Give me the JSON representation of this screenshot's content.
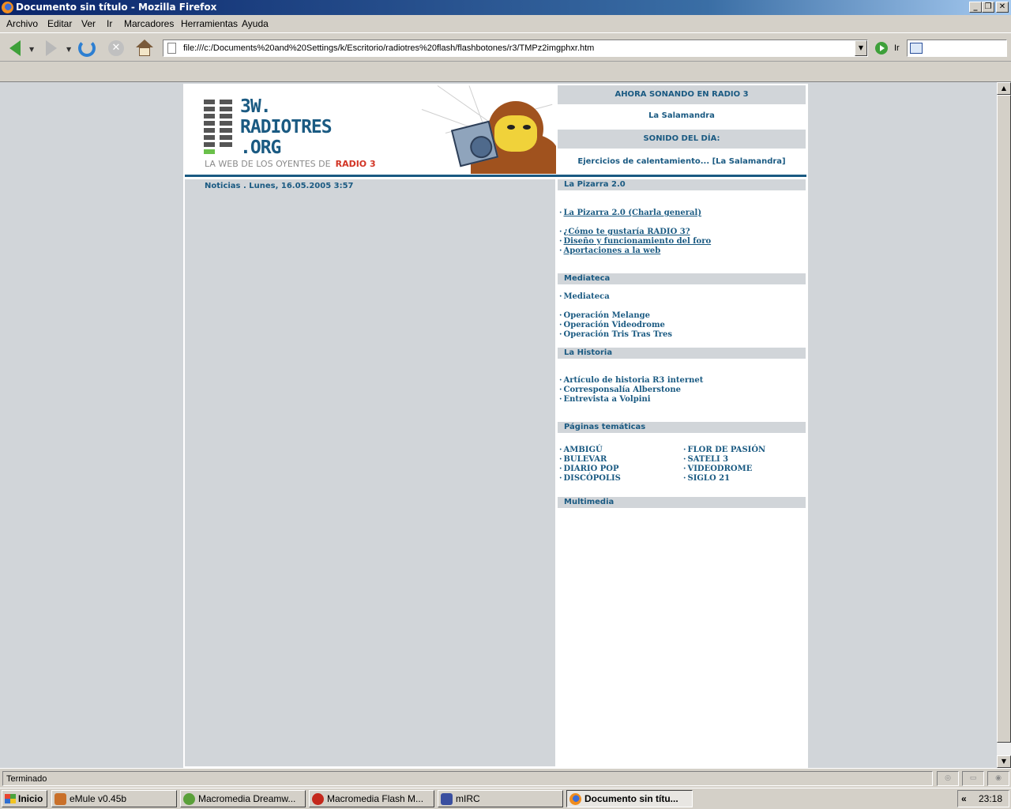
{
  "window": {
    "title": "Documento sin título - Mozilla Firefox"
  },
  "menu": [
    "Archivo",
    "Editar",
    "Ver",
    "Ir",
    "Marcadores",
    "Herramientas",
    "Ayuda"
  ],
  "toolbar": {
    "url": "file:///c:/Documents%20and%20Settings/k/Escritorio/radiotres%20flash/flashbotones/r3/TMPz2imgphxr.htm",
    "go_label": "Ir"
  },
  "banner": {
    "logo_line1": "3W.",
    "logo_line2": "RADIOTRES",
    "logo_line3": ".ORG",
    "tagline": "LA WEB DE LOS OYENTES DE",
    "tagline_accent": "RADIO 3",
    "accent_color": "#d23424"
  },
  "now_playing": {
    "heading": "AHORA SONANDO EN RADIO 3",
    "value": "La Salamandra",
    "sound_heading": "SONIDO DEL DÍA:",
    "sound_value": "Ejercicios de calentamiento... [La Salamandra]"
  },
  "news": {
    "date_line": "Noticias . Lunes, 16.05.2005 3:57"
  },
  "sections": {
    "pizarra": {
      "title": "La Pizarra 2.0",
      "links": [
        "La Pizarra 2.0 (Charla general)",
        "¿Cómo te gustaría RADIO 3?",
        "Diseño y funcionamiento del foro",
        "Aportaciones a la web"
      ]
    },
    "mediateca": {
      "title": "Mediateca",
      "links": [
        "Mediateca",
        "Operación Melange",
        "Operación Videodrome",
        "Operación Tris Tras Tres"
      ]
    },
    "historia": {
      "title": "La Historia",
      "links": [
        "Artículo de historia R3 internet",
        "Corresponsalía Alberstone",
        "Entrevista a Volpini"
      ]
    },
    "tematicas": {
      "title": "Páginas temáticas",
      "left": [
        "AMBIGÚ",
        "BULEVAR",
        "DIARIO POP",
        "DISCÓPOLIS"
      ],
      "right": [
        "FLOR DE PASIÓN",
        "SATELI 3",
        "VIDEODROME",
        "SIGLO 21"
      ]
    },
    "multimedia": {
      "title": "Multimedia"
    }
  },
  "status": {
    "text": "Terminado"
  },
  "taskbar": {
    "start": "Inicio",
    "tasks": [
      "eMule v0.45b",
      "Macromedia Dreamw...",
      "Macromedia Flash M...",
      "mIRC",
      "Documento sin títu..."
    ],
    "clock": "23:18"
  },
  "colors": {
    "link": "#1a5a82",
    "section_bg": "#d1d5d9"
  }
}
